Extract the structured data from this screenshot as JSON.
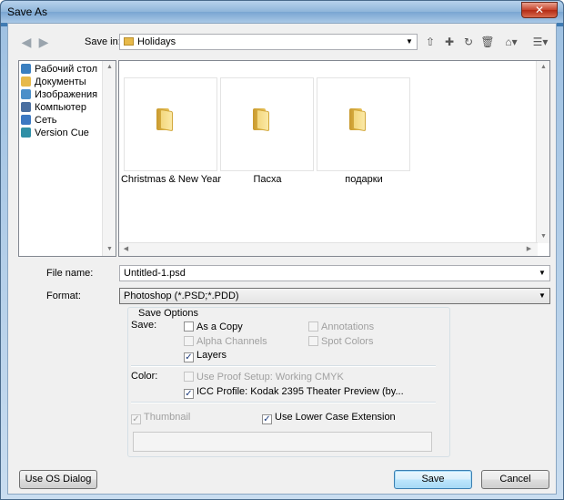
{
  "window": {
    "title": "Save As",
    "close_label": "✕"
  },
  "toolbar": {
    "save_in_label": "Save in:",
    "save_in_value": "Holidays",
    "back_icon": "back-arrow-icon",
    "forward_icon": "forward-arrow-icon",
    "icons": [
      "up-folder-icon",
      "new-folder-icon",
      "refresh-icon",
      "delete-icon",
      "tools-icon",
      "views-icon"
    ]
  },
  "places": [
    {
      "label": "Рабочий стол",
      "icon": "desktop-icon",
      "color": "#3a7fc0"
    },
    {
      "label": "Документы",
      "icon": "documents-folder-icon",
      "color": "#e7b94a"
    },
    {
      "label": "Изображения",
      "icon": "pictures-icon",
      "color": "#4b8fc9"
    },
    {
      "label": "Компьютер",
      "icon": "computer-icon",
      "color": "#4a6fa0"
    },
    {
      "label": "Сеть",
      "icon": "network-icon",
      "color": "#3b78c2"
    },
    {
      "label": "Version Cue",
      "icon": "version-cue-icon",
      "color": "#2f8fa6"
    }
  ],
  "folders": [
    {
      "label": "Christmas & New Year"
    },
    {
      "label": "Пасха"
    },
    {
      "label": "подарки"
    }
  ],
  "file_name": {
    "label": "File name:",
    "value": "Untitled-1.psd"
  },
  "format": {
    "label": "Format:",
    "value": "Photoshop (*.PSD;*.PDD)"
  },
  "save_options": {
    "title": "Save Options",
    "save_label": "Save:",
    "as_a_copy": {
      "label": "As a Copy",
      "checked": false,
      "enabled": true
    },
    "annotations": {
      "label": "Annotations",
      "checked": false,
      "enabled": false
    },
    "alpha_channels": {
      "label": "Alpha Channels",
      "checked": false,
      "enabled": false
    },
    "spot_colors": {
      "label": "Spot Colors",
      "checked": false,
      "enabled": false
    },
    "layers": {
      "label": "Layers",
      "checked": true,
      "enabled": true
    },
    "color_label": "Color:",
    "use_proof_setup": {
      "label": "Use Proof Setup:  Working CMYK",
      "checked": false,
      "enabled": false
    },
    "icc_profile": {
      "label": "ICC Profile:  Kodak 2395 Theater Preview (by...",
      "checked": true,
      "enabled": true
    },
    "thumbnail": {
      "label": "Thumbnail",
      "checked": true,
      "enabled": false
    },
    "lower_case": {
      "label": "Use Lower Case Extension",
      "checked": true,
      "enabled": true
    }
  },
  "buttons": {
    "os_dialog": "Use OS Dialog",
    "save": "Save",
    "cancel": "Cancel"
  }
}
